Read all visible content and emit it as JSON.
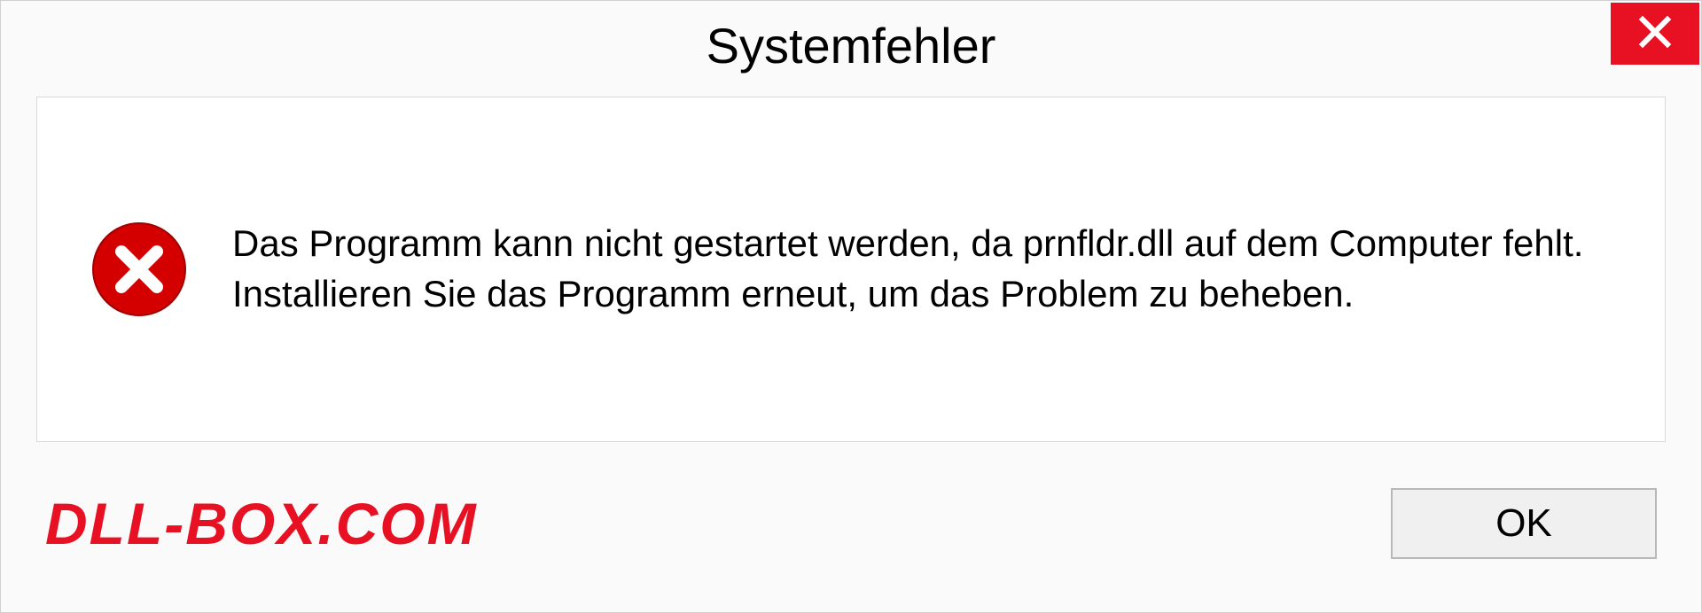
{
  "dialog": {
    "title": "Systemfehler",
    "message": "Das Programm kann nicht gestartet werden, da prnfldr.dll auf dem Computer fehlt. Installieren Sie das Programm erneut, um das Problem zu beheben.",
    "ok_label": "OK"
  },
  "watermark": "DLL-BOX.COM",
  "colors": {
    "close_red": "#e81123",
    "error_red": "#d40000"
  }
}
